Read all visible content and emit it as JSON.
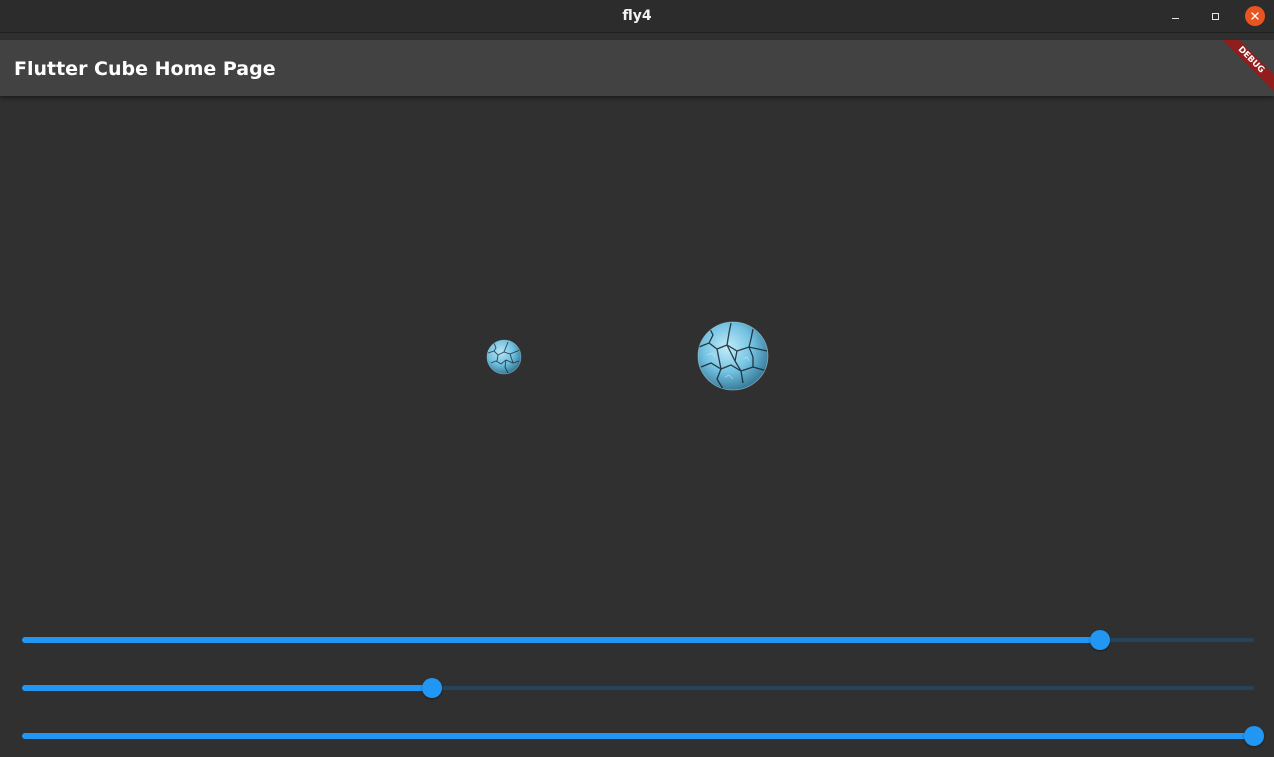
{
  "window": {
    "title": "fly4",
    "controls": {
      "minimize": "minimize-icon",
      "maximize": "maximize-icon",
      "close": "close-icon"
    },
    "close_color": "#e95420"
  },
  "appbar": {
    "title": "Flutter Cube Home Page",
    "debug_banner": "DEBUG"
  },
  "scene": {
    "objects": [
      {
        "name": "small-sphere",
        "texture": "cracked blue ice"
      },
      {
        "name": "large-sphere",
        "texture": "cracked blue ice"
      }
    ]
  },
  "sliders": [
    {
      "name": "slider-1",
      "value": 0.875
    },
    {
      "name": "slider-2",
      "value": 0.333
    },
    {
      "name": "slider-3",
      "value": 1.0
    }
  ],
  "colors": {
    "background": "#303030",
    "appbar": "#424242",
    "accent": "#2196f3",
    "inactive_track": "#21445f",
    "debug_banner": "#a01616"
  }
}
